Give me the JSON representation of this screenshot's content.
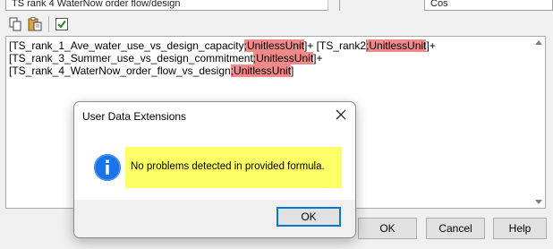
{
  "top": {
    "name_field_value": "TS rank 4 WaterNow order flow/design",
    "function_field_value": "Cos"
  },
  "toolbar": {
    "copy_icon": "copy-icon",
    "paste_icon": "paste-icon",
    "check_icon": "check-formula-icon"
  },
  "formula": {
    "line1_a": "[TS_rank_1_Ave_water_use_vs_design_capacity",
    "line1_tag1": ";UnitlessUnit",
    "line1_b": "]+ [TS_rank2",
    "line1_tag2": ";UnitlessUnit",
    "line1_c": "]+",
    "line2_a": "[TS_rank_3_Summer_use_vs_design_commitment",
    "line2_tag": ";UnitlessUnit",
    "line2_b": "]+",
    "line3_a": "[TS_rank_4_WaterNow_order_flow_vs_design",
    "line3_tag": ";UnitlessUnit",
    "line3_b": "]"
  },
  "buttons": {
    "ok": "OK",
    "cancel": "Cancel",
    "help": "Help"
  },
  "dialog": {
    "title": "User Data Extensions",
    "message": "No problems detected in provided formula.",
    "ok": "OK",
    "highlight_color": "#ffff66",
    "info_color": "#1a73e8"
  },
  "colors": {
    "unit_tag": "#f08a8a",
    "focus_border": "#0078d7"
  }
}
